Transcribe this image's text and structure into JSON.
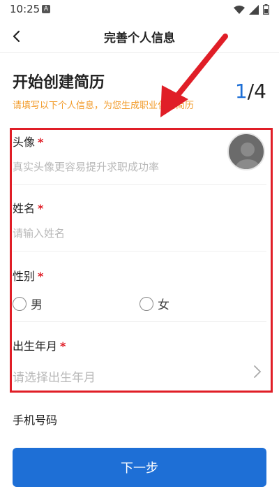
{
  "status_bar": {
    "time": "10:25",
    "notif_letter": "A"
  },
  "nav": {
    "title": "完善个人信息"
  },
  "hero": {
    "title": "开始创建简历",
    "subtitle": "请填写以下个人信息，为您生成职业化的简历",
    "step_current": "1",
    "step_total": "/4"
  },
  "fields": {
    "avatar": {
      "label": "头像",
      "required": "*",
      "hint": "真实头像更容易提升求职成功率"
    },
    "name": {
      "label": "姓名",
      "required": "*",
      "placeholder": "请输入姓名"
    },
    "gender": {
      "label": "性别",
      "required": "*",
      "options": [
        "男",
        "女"
      ]
    },
    "birth": {
      "label": "出生年月",
      "required": "*",
      "placeholder": "请选择出生年月"
    },
    "phone": {
      "label": "手机号码"
    }
  },
  "footer": {
    "next_label": "下一步"
  },
  "colors": {
    "accent": "#1e6fd6",
    "highlight": "#e01e27",
    "hint": "#f29b2a"
  }
}
